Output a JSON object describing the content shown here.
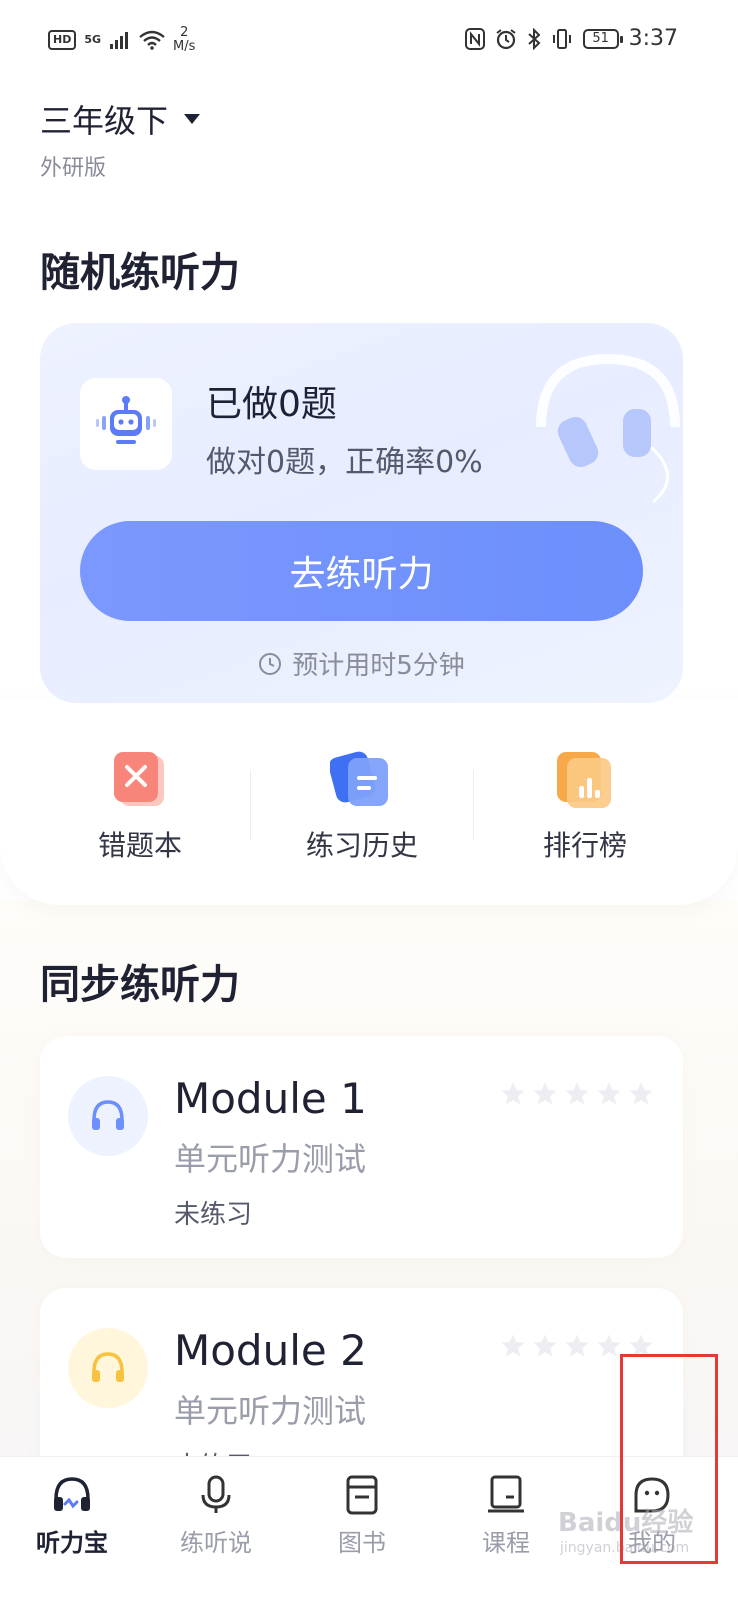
{
  "status_bar": {
    "hd": "HD",
    "network": "5G",
    "speed_value": "2",
    "speed_unit": "M/s",
    "battery": "51",
    "time": "3:37"
  },
  "grade": {
    "title": "三年级下",
    "edition": "外研版"
  },
  "random_practice": {
    "section_title": "随机练听力",
    "done_text": "已做0题",
    "accuracy_text": "做对0题，正确率0%",
    "button_label": "去练听力",
    "eta_text": "预计用时5分钟"
  },
  "quick_actions": [
    {
      "label": "错题本",
      "icon": "wrong-book-icon",
      "color": "#f7857a"
    },
    {
      "label": "练习历史",
      "icon": "history-icon",
      "color": "#5b86f7"
    },
    {
      "label": "排行榜",
      "icon": "ranking-icon",
      "color": "#f7a94a"
    }
  ],
  "sync_practice": {
    "section_title": "同步练听力",
    "modules": [
      {
        "title": "Module 1",
        "subtitle": "单元听力测试",
        "status": "未练习",
        "stars": 0,
        "icon_color": "#6c8ffb"
      },
      {
        "title": "Module 2",
        "subtitle": "单元听力测试",
        "status": "未练习",
        "stars": 0,
        "icon_color": "#f7c23d"
      }
    ]
  },
  "bottom_nav": [
    {
      "label": "听力宝",
      "icon": "headphone-icon",
      "active": true
    },
    {
      "label": "练听说",
      "icon": "microphone-icon",
      "active": false
    },
    {
      "label": "图书",
      "icon": "book-icon",
      "active": false
    },
    {
      "label": "课程",
      "icon": "course-icon",
      "active": false
    },
    {
      "label": "我的",
      "icon": "profile-icon",
      "active": false
    }
  ],
  "watermark": {
    "text": "Baidu经验",
    "sub": "jingyan.baidu.com"
  }
}
